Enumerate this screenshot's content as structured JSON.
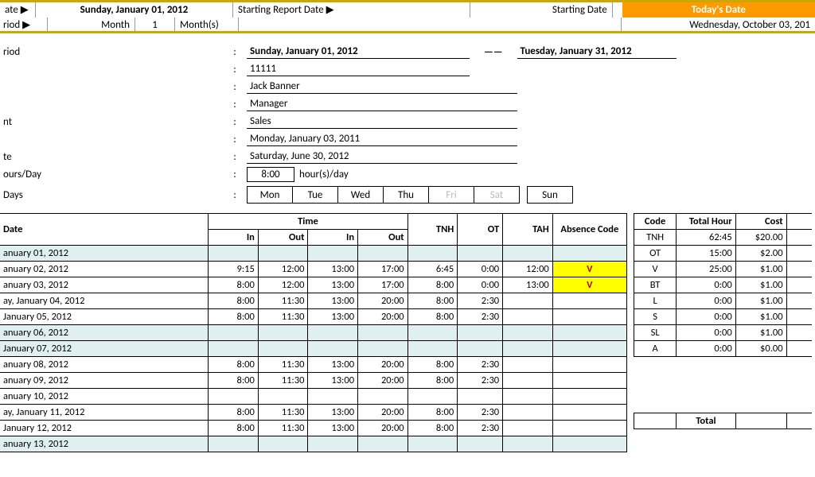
{
  "topbar": {
    "date_label": "ate ▶",
    "date_value": "Sunday, January 01, 2012",
    "report_label": "Starting Report Date ▶",
    "starting_date": "Starting Date",
    "today_label": "Today's Date",
    "period_label": "riod ▶",
    "month": "Month",
    "month_n": "1",
    "months": "Month(s)",
    "today_value": "Wednesday, October 03, 201"
  },
  "info": {
    "period_lbl": "riod",
    "start": "Sunday, January 01, 2012",
    "dash": "——",
    "end": "Tuesday, January 31, 2012",
    "id": "11111",
    "name": "Jack Banner",
    "title": "Manager",
    "nt_lbl": "nt",
    "dept": "Sales",
    "hire": "Monday, January 03, 2011",
    "te_lbl": "te",
    "leave": "Saturday, June 30, 2012",
    "hours_lbl": "ours/Day",
    "hours_val": "8:00",
    "hours_unit": "hour(s)/day",
    "days_lbl": "Days",
    "days": [
      "Mon",
      "Tue",
      "Wed",
      "Thu",
      "Fri",
      "Sat",
      "Sun"
    ]
  },
  "headers": {
    "date": "Date",
    "time": "Time",
    "in": "In",
    "out": "Out",
    "tnh": "TNH",
    "ot": "OT",
    "tah": "TAH",
    "abs": "Absence Code",
    "code": "Code",
    "thour": "Total Hour",
    "cost": "Cost",
    "total": "Total"
  },
  "rows": [
    {
      "date": "anuary 01, 2012",
      "wk": true
    },
    {
      "date": "anuary 02, 2012",
      "in1": "9:15",
      "out1": "12:00",
      "in2": "13:00",
      "out2": "17:00",
      "tnh": "6:45",
      "ot": "0:00",
      "tah": "12:00",
      "abs": "V"
    },
    {
      "date": "anuary 03, 2012",
      "in1": "8:00",
      "out1": "12:00",
      "in2": "13:00",
      "out2": "17:00",
      "tnh": "8:00",
      "ot": "0:00",
      "tah": "13:00",
      "abs": "V"
    },
    {
      "date": "ay, January 04, 2012",
      "in1": "8:00",
      "out1": "11:30",
      "in2": "13:00",
      "out2": "20:00",
      "tnh": "8:00",
      "ot": "2:30"
    },
    {
      "date": " January 05, 2012",
      "in1": "8:00",
      "out1": "11:30",
      "in2": "13:00",
      "out2": "20:00",
      "tnh": "8:00",
      "ot": "2:30"
    },
    {
      "date": "anuary 06, 2012",
      "wk": true
    },
    {
      "date": " January 07, 2012",
      "wk": true
    },
    {
      "date": "anuary 08, 2012",
      "in1": "8:00",
      "out1": "11:30",
      "in2": "13:00",
      "out2": "20:00",
      "tnh": "8:00",
      "ot": "2:30"
    },
    {
      "date": "anuary 09, 2012",
      "in1": "8:00",
      "out1": "11:30",
      "in2": "13:00",
      "out2": "20:00",
      "tnh": "8:00",
      "ot": "2:30"
    },
    {
      "date": "anuary 10, 2012"
    },
    {
      "date": "ay, January 11, 2012",
      "in1": "8:00",
      "out1": "11:30",
      "in2": "13:00",
      "out2": "20:00",
      "tnh": "8:00",
      "ot": "2:30"
    },
    {
      "date": " January 12, 2012",
      "in1": "8:00",
      "out1": "11:30",
      "in2": "13:00",
      "out2": "20:00",
      "tnh": "8:00",
      "ot": "2:30"
    },
    {
      "date": "anuary 13, 2012",
      "wk": true
    }
  ],
  "summary": [
    {
      "code": "TNH",
      "hour": "62:45",
      "cost": "$20.00"
    },
    {
      "code": "OT",
      "hour": "15:00",
      "cost": "$2.00"
    },
    {
      "code": "V",
      "hour": "25:00",
      "cost": "$1.00"
    },
    {
      "code": "BT",
      "hour": "0:00",
      "cost": "$1.00"
    },
    {
      "code": "L",
      "hour": "0:00",
      "cost": "$1.00"
    },
    {
      "code": "S",
      "hour": "0:00",
      "cost": "$1.00"
    },
    {
      "code": "SL",
      "hour": "0:00",
      "cost": "$1.00"
    },
    {
      "code": "A",
      "hour": "0:00",
      "cost": "$0.00"
    }
  ]
}
